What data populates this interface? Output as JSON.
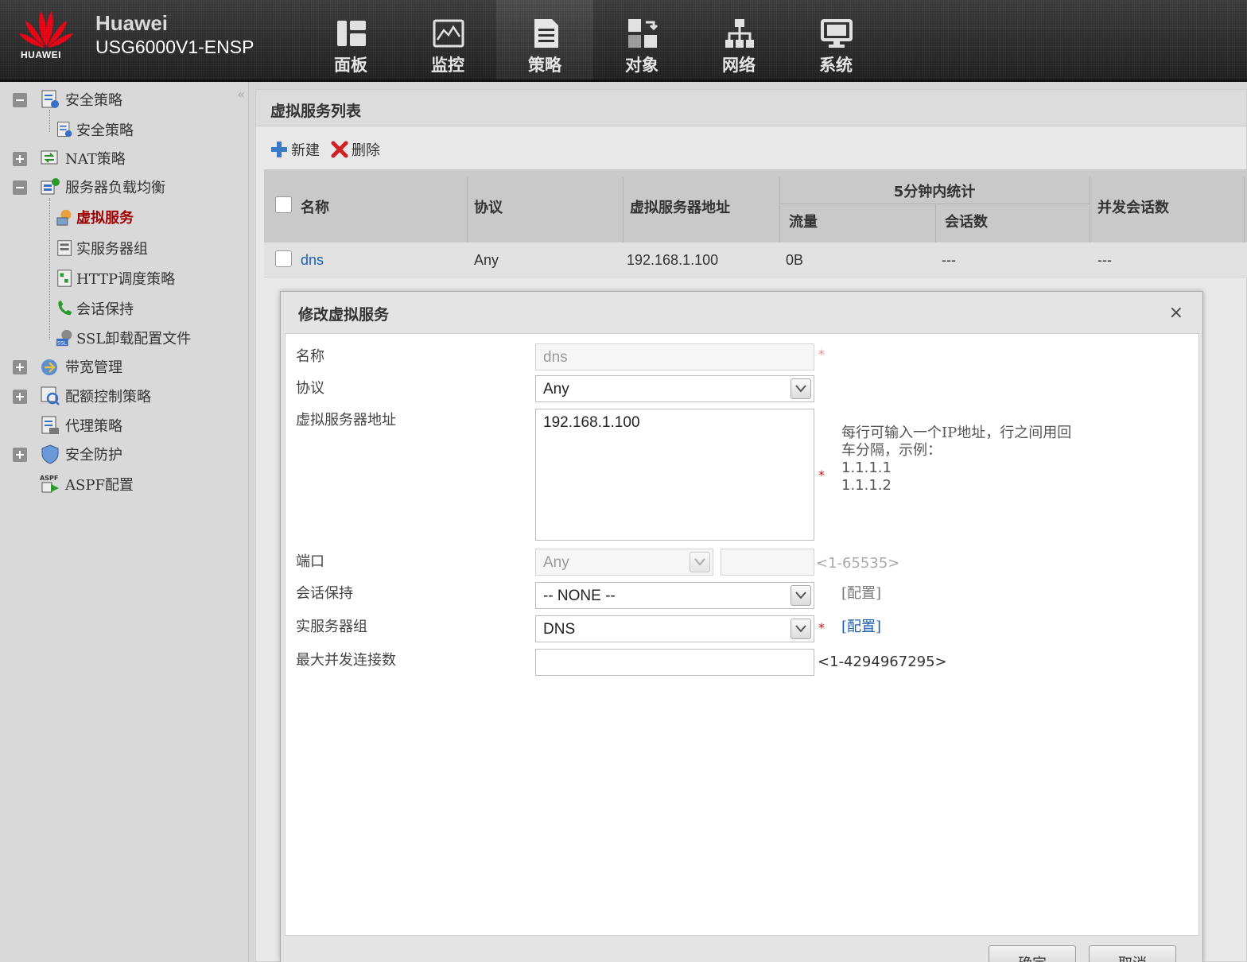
{
  "header": {
    "logo_text": "HUAWEI",
    "brand": "Huawei",
    "model": "USG6000V1-ENSP",
    "nav": [
      {
        "label": "面板",
        "icon": "dashboard-icon"
      },
      {
        "label": "监控",
        "icon": "monitor-icon"
      },
      {
        "label": "策略",
        "icon": "policy-icon",
        "active": true
      },
      {
        "label": "对象",
        "icon": "object-icon"
      },
      {
        "label": "网络",
        "icon": "network-icon"
      },
      {
        "label": "系统",
        "icon": "system-icon"
      }
    ]
  },
  "sidebar": {
    "items": [
      {
        "label": "安全策略",
        "icon": "security-policy-icon",
        "expandable": "minus"
      },
      {
        "label": "安全策略",
        "icon": "security-policy-icon",
        "child": true
      },
      {
        "label": "NAT策略",
        "icon": "nat-icon",
        "expandable": "plus"
      },
      {
        "label": "服务器负载均衡",
        "icon": "slb-icon",
        "expandable": "minus"
      },
      {
        "label": "虚拟服务",
        "icon": "virtual-service-icon",
        "child": true,
        "active": true
      },
      {
        "label": "实服务器组",
        "icon": "server-group-icon",
        "child": true
      },
      {
        "label": "HTTP调度策略",
        "icon": "http-schedule-icon",
        "child": true
      },
      {
        "label": "会话保持",
        "icon": "session-keep-icon",
        "child": true
      },
      {
        "label": "SSL卸载配置文件",
        "icon": "ssl-icon",
        "child": true
      },
      {
        "label": "带宽管理",
        "icon": "bandwidth-icon",
        "expandable": "plus"
      },
      {
        "label": "配额控制策略",
        "icon": "quota-icon",
        "expandable": "plus"
      },
      {
        "label": "代理策略",
        "icon": "proxy-icon"
      },
      {
        "label": "安全防护",
        "icon": "shield-icon",
        "expandable": "plus"
      },
      {
        "label": "ASPF配置",
        "icon": "aspf-icon"
      }
    ]
  },
  "main": {
    "title": "虚拟服务列表",
    "toolbar": {
      "new_label": "新建",
      "delete_label": "删除"
    },
    "table": {
      "headers": {
        "name": "名称",
        "protocol": "协议",
        "address": "虚拟服务器地址",
        "stats_group": "5分钟内统计",
        "traffic": "流量",
        "sessions": "会话数",
        "concurrent": "并发会话数"
      },
      "rows": [
        {
          "name": "dns",
          "protocol": "Any",
          "address": "192.168.1.100",
          "traffic": "0B",
          "sessions": "---",
          "concurrent": "---"
        }
      ]
    }
  },
  "dialog": {
    "title": "修改虚拟服务",
    "close": "×",
    "fields": {
      "name": {
        "label": "名称",
        "value": "dns"
      },
      "protocol": {
        "label": "协议",
        "value": "Any"
      },
      "address": {
        "label": "虚拟服务器地址",
        "value": "192.168.1.100",
        "hint_line1": "每行可输入一个IP地址，行之间用回",
        "hint_line2": "车分隔，示例：",
        "hint_ex1": "1.1.1.1",
        "hint_ex2": "1.1.1.2"
      },
      "port": {
        "label": "端口",
        "value": "Any",
        "range": "<1-65535>"
      },
      "session": {
        "label": "会话保持",
        "value": "-- NONE --",
        "config": "[配置]"
      },
      "server_group": {
        "label": "实服务器组",
        "value": "DNS",
        "config": "[配置]"
      },
      "max_conn": {
        "label": "最大并发连接数",
        "value": "",
        "range": "<1-4294967295>"
      }
    },
    "required_mark": "*",
    "ok_label": "确定",
    "cancel_label": "取消"
  },
  "colors": {
    "accent_red": "#a00000",
    "link_blue": "#1a5fb4",
    "required": "#d01010",
    "huawei_red": "#e60012"
  }
}
